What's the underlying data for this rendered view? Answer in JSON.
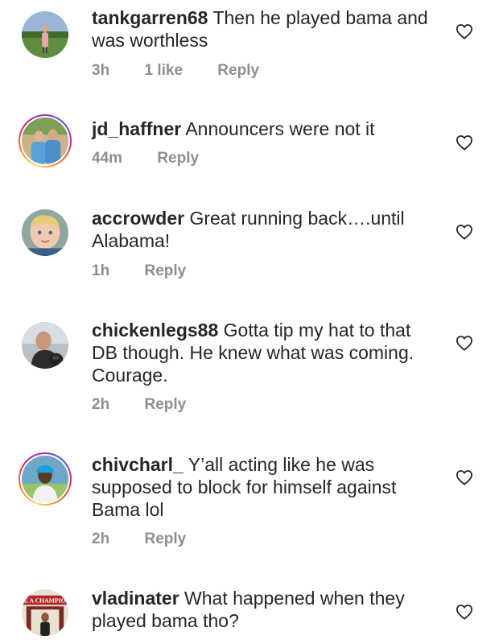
{
  "comments": [
    {
      "username": "tankgarren68",
      "text": "Then he played bama and was worthless",
      "time": "3h",
      "likes": "1 like",
      "reply": "Reply",
      "icon": "heart-outline-icon"
    },
    {
      "username": "jd_haffner",
      "text": "Announcers were not it",
      "time": "44m",
      "reply": "Reply",
      "icon": "heart-outline-icon"
    },
    {
      "username": "accrowder",
      "text": "Great running back….until Alabama!",
      "time": "1h",
      "reply": "Reply",
      "icon": "heart-outline-icon"
    },
    {
      "username": "chickenlegs88",
      "text": "Gotta tip my hat to that DB though. He knew what was coming. Courage.",
      "time": "2h",
      "reply": "Reply",
      "icon": "heart-outline-icon"
    },
    {
      "username": "chivcharl_",
      "text": "Y’all acting like he was supposed to block for himself against Bama lol",
      "time": "2h",
      "reply": "Reply",
      "icon": "heart-outline-icon"
    },
    {
      "username": "vladinater",
      "text": "What happened when they played bama tho?",
      "avatar_text": "BE A CHAMPION",
      "icon": "heart-outline-icon"
    }
  ],
  "colors": {
    "text": "#262626",
    "secondary": "#8e8e8e",
    "story_ring": "#d62976"
  }
}
